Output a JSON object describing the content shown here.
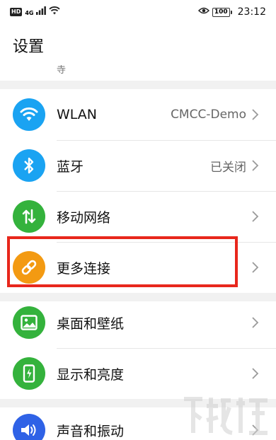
{
  "status_bar": {
    "left_badge": "HD",
    "signal_label": "4G",
    "battery_level": "100",
    "time": "23:12"
  },
  "header": {
    "title": "设置",
    "search_hint": "寺"
  },
  "settings_items": [
    {
      "label": "WLAN",
      "value": "CMCC-Demo",
      "icon": "wifi-icon",
      "color": "#1aa3f2"
    },
    {
      "label": "蓝牙",
      "value": "已关闭",
      "icon": "bluetooth-icon",
      "color": "#1aa3f2"
    },
    {
      "label": "移动网络",
      "value": "",
      "icon": "mobile-data-icon",
      "color": "#34b23c"
    },
    {
      "label": "更多连接",
      "value": "",
      "icon": "link-icon",
      "color": "#f39a12"
    },
    {
      "label": "桌面和壁纸",
      "value": "",
      "icon": "wallpaper-icon",
      "color": "#34b23c"
    },
    {
      "label": "显示和亮度",
      "value": "",
      "icon": "display-icon",
      "color": "#34b23c"
    },
    {
      "label": "声音和振动",
      "value": "",
      "icon": "sound-icon",
      "color": "#2f62e6"
    }
  ],
  "highlight": {
    "color": "#e8271c"
  }
}
